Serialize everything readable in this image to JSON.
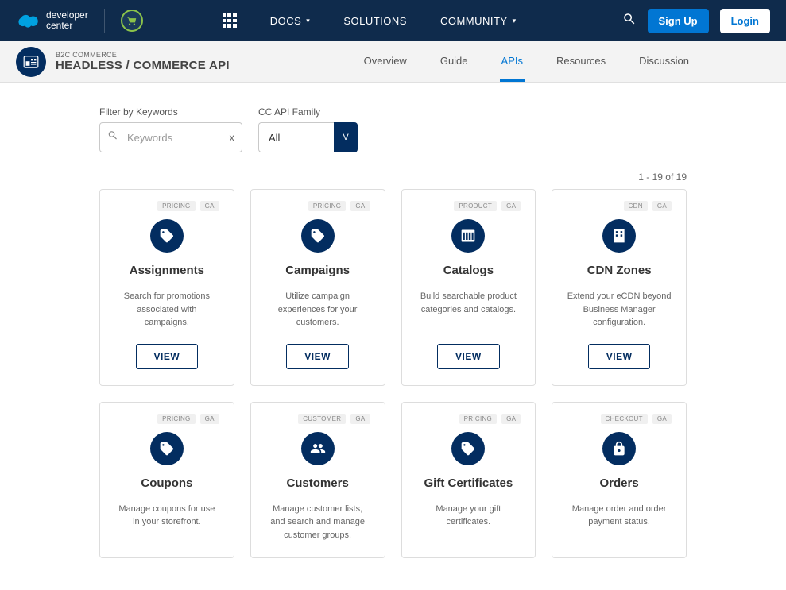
{
  "topNav": {
    "brand1": "developer",
    "brand2": "center",
    "items": {
      "docs": "DOCS",
      "solutions": "SOLUTIONS",
      "community": "COMMUNITY"
    },
    "signup": "Sign Up",
    "login": "Login"
  },
  "subHeader": {
    "eyebrow": "B2C COMMERCE",
    "title": "HEADLESS / COMMERCE API",
    "tabs": {
      "overview": "Overview",
      "guide": "Guide",
      "apis": "APIs",
      "resources": "Resources",
      "discussion": "Discussion"
    }
  },
  "filters": {
    "kwLabel": "Filter by Keywords",
    "kwPlaceholder": "Keywords",
    "kwClear": "x",
    "famLabel": "CC API Family",
    "famValue": "All",
    "famChevron": "V"
  },
  "results": {
    "count": "1 - 19 of 19"
  },
  "viewLabel": "VIEW",
  "cards": [
    {
      "cat": "PRICING",
      "status": "GA",
      "title": "Assignments",
      "desc": "Search for promotions associated with campaigns.",
      "icon": "tag"
    },
    {
      "cat": "PRICING",
      "status": "GA",
      "title": "Campaigns",
      "desc": "Utilize campaign experiences for your customers.",
      "icon": "tag"
    },
    {
      "cat": "PRODUCT",
      "status": "GA",
      "title": "Catalogs",
      "desc": "Build searchable product categories and catalogs.",
      "icon": "columns"
    },
    {
      "cat": "CDN",
      "status": "GA",
      "title": "CDN Zones",
      "desc": "Extend your eCDN beyond Business Manager configuration.",
      "icon": "building"
    },
    {
      "cat": "PRICING",
      "status": "GA",
      "title": "Coupons",
      "desc": "Manage coupons for use in your storefront.",
      "icon": "tag"
    },
    {
      "cat": "CUSTOMER",
      "status": "GA",
      "title": "Customers",
      "desc": "Manage customer lists, and search and manage customer groups.",
      "icon": "people"
    },
    {
      "cat": "PRICING",
      "status": "GA",
      "title": "Gift Certificates",
      "desc": "Manage your gift certificates.",
      "icon": "tag"
    },
    {
      "cat": "CHECKOUT",
      "status": "GA",
      "title": "Orders",
      "desc": "Manage order and order payment status.",
      "icon": "lock"
    }
  ]
}
